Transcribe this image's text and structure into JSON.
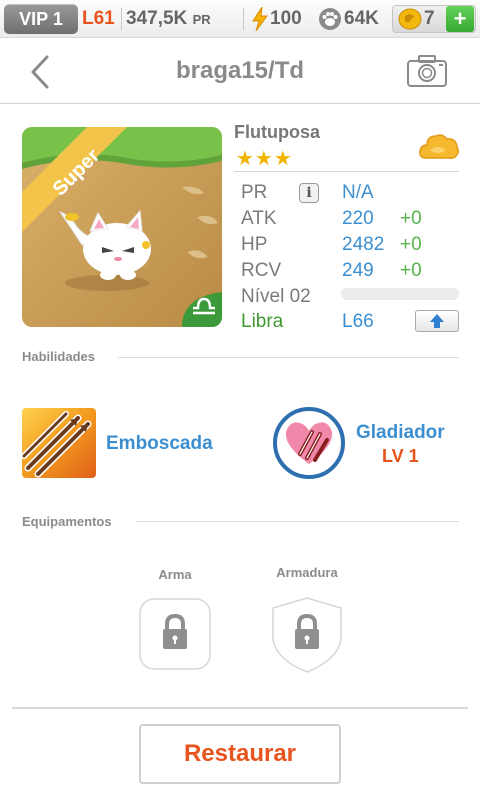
{
  "topbar": {
    "vip": "VIP 1",
    "level": "L61",
    "pr_value": "347,5K",
    "pr_unit": "PR",
    "energy": "100",
    "paws": "64K",
    "coins": "7",
    "plus": "+"
  },
  "header": {
    "title": "braga15/Td",
    "back_icon": "chevron-left-icon",
    "camera_icon": "camera-icon"
  },
  "pet": {
    "name": "Flutuposa",
    "stars": "★★★",
    "badge": "Super",
    "element_icon": "cloud-element-icon",
    "sign_icon": "libra-icon",
    "stats": {
      "pr_label": "PR",
      "pr_value": "N/A",
      "atk_label": "ATK",
      "atk_value": "220",
      "atk_bonus": "+0",
      "hp_label": "HP",
      "hp_value": "2482",
      "hp_bonus": "+0",
      "rcv_label": "RCV",
      "rcv_value": "249",
      "rcv_bonus": "+0",
      "level_label": "Nível 02",
      "level_progress": 0
    },
    "sign_label": "Libra",
    "sign_level": "L66"
  },
  "skills": {
    "section_title": "Habilidades",
    "items": [
      {
        "name": "Emboscada",
        "icon": "claw-scratch-icon"
      },
      {
        "name": "Gladiador",
        "level": "LV 1",
        "icon": "scratched-heart-icon"
      }
    ]
  },
  "equipment": {
    "section_title": "Equipamentos",
    "weapon_label": "Arma",
    "armor_label": "Armadura"
  },
  "footer": {
    "restore_label": "Restaurar"
  }
}
